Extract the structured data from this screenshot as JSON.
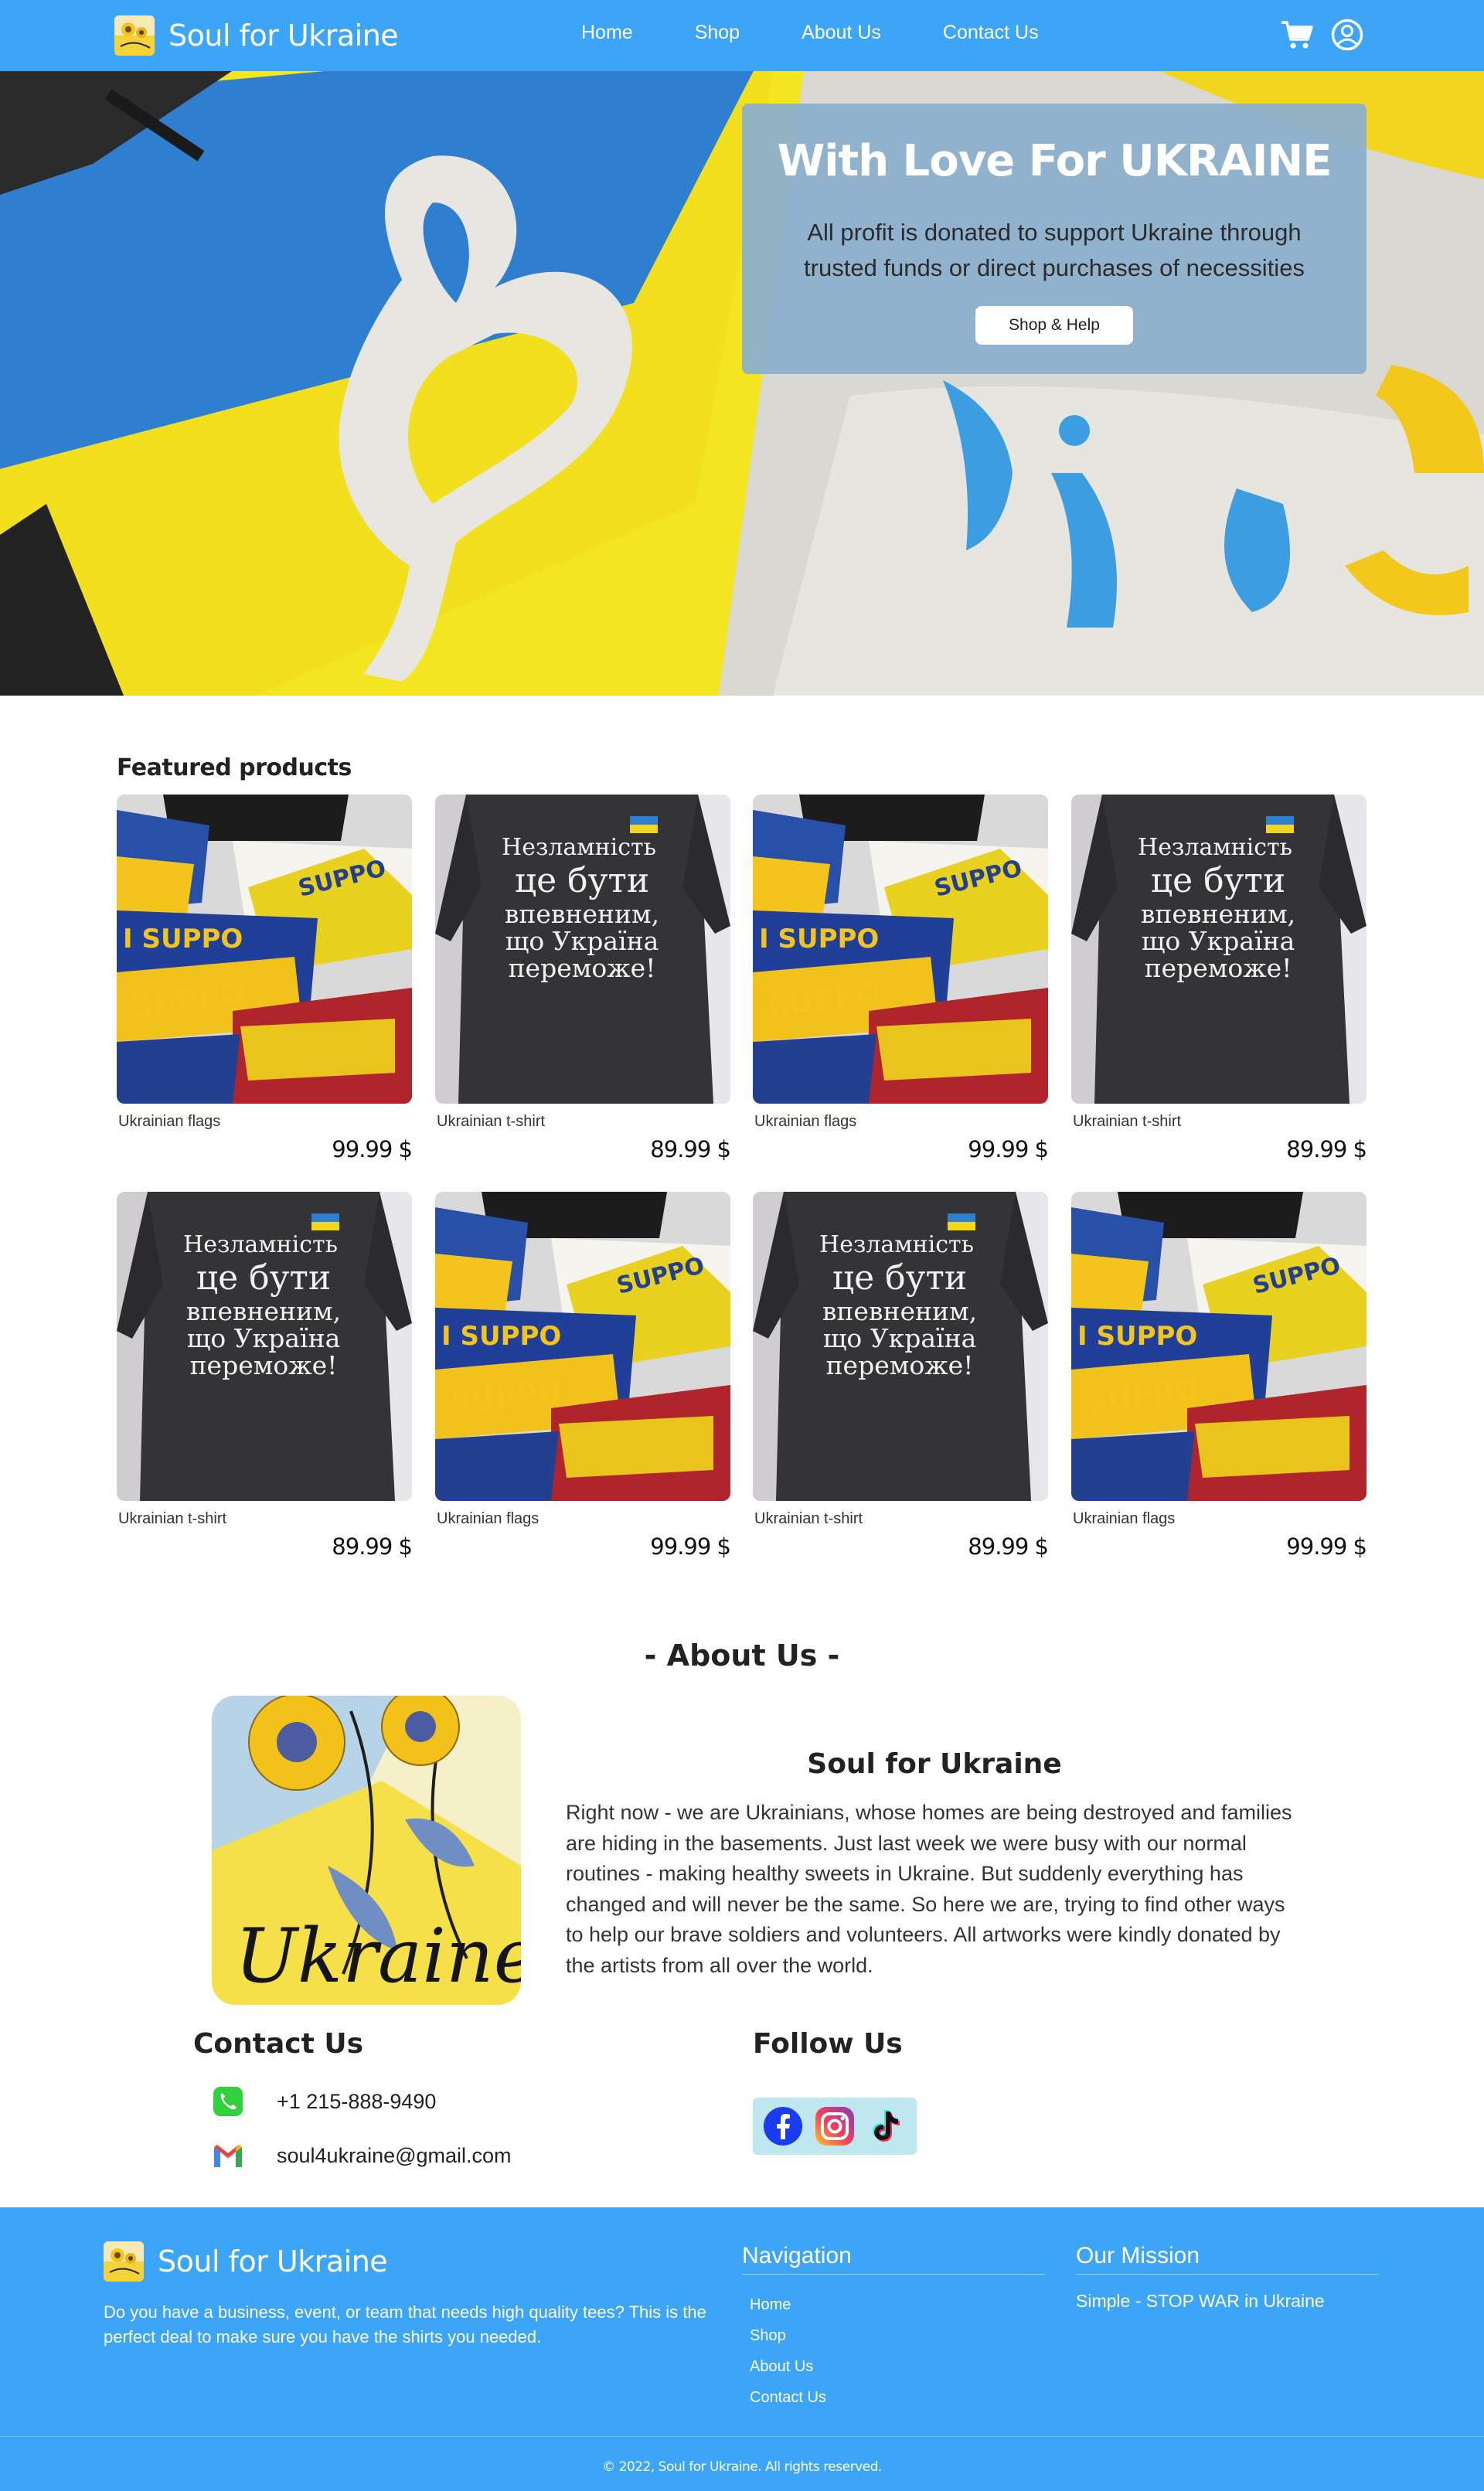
{
  "header": {
    "brand": "Soul for Ukraine",
    "nav": [
      "Home",
      "Shop",
      "About Us",
      "Contact Us"
    ],
    "cart_icon": "cart-icon",
    "account_icon": "user-circle-icon"
  },
  "hero": {
    "title": "With Love For UKRAINE",
    "subtitle": "All profit is donated to support Ukraine through trusted funds or direct purchases of necessities",
    "button": "Shop & Help"
  },
  "products": {
    "title": "Featured products",
    "items": [
      {
        "name": "Ukrainian flags",
        "price": "99.99 $",
        "image": "flags"
      },
      {
        "name": "Ukrainian t-shirt",
        "price": "89.99 $",
        "image": "tshirt"
      },
      {
        "name": "Ukrainian flags",
        "price": "99.99 $",
        "image": "flags"
      },
      {
        "name": "Ukrainian t-shirt",
        "price": "89.99 $",
        "image": "tshirt"
      },
      {
        "name": "Ukrainian t-shirt",
        "price": "89.99 $",
        "image": "tshirt"
      },
      {
        "name": "Ukrainian flags",
        "price": "99.99 $",
        "image": "flags"
      },
      {
        "name": "Ukrainian t-shirt",
        "price": "89.99 $",
        "image": "tshirt"
      },
      {
        "name": "Ukrainian flags",
        "price": "99.99 $",
        "image": "flags"
      }
    ],
    "tshirt_print": [
      "Незламність",
      "це бути",
      "впевненим,",
      "що Україна",
      "переможе!"
    ],
    "flag_print": [
      "I SUPPO",
      "SUPPO",
      "SUPPO"
    ]
  },
  "about": {
    "title": "- About Us -",
    "name": "Soul for Ukraine",
    "text": "Right now - we are Ukrainians, whose homes are being destroyed and families are hiding in the basements. Just last week we were busy with our normal routines - making healthy sweets in Ukraine. But suddenly everything has changed and will never be the same. So here we are, trying to find other ways to help our brave soldiers and volunteers. All artworks were kindly donated by the artists from all over the world.",
    "image_caption": "Ukraine"
  },
  "contact": {
    "title": "Contact Us",
    "phone": "+1 215-888-9490",
    "email": "soul4ukraine@gmail.com",
    "phone_icon": "phone-icon",
    "email_icon": "gmail-icon"
  },
  "follow": {
    "title": "Follow Us",
    "icons": [
      "facebook-icon",
      "instagram-icon",
      "tiktok-icon"
    ]
  },
  "footer": {
    "brand": "Soul for Ukraine",
    "description": "Do you have a business, event, or team that needs high quality tees? This is the perfect deal to make sure you have the shirts you needed.",
    "nav_title": "Navigation",
    "nav": [
      "Home",
      "Shop",
      "About Us",
      "Contact Us"
    ],
    "mission_title": "Our Mission",
    "mission": "Simple - STOP WAR in Ukraine",
    "copyright": "© 2022, Soul for Ukraine. All rights reserved."
  },
  "colors": {
    "primary": "#3da5f7",
    "hero_card": "#8cb0cc",
    "ukraine_blue": "#2f7fd0",
    "ukraine_yellow": "#fbe01c"
  }
}
